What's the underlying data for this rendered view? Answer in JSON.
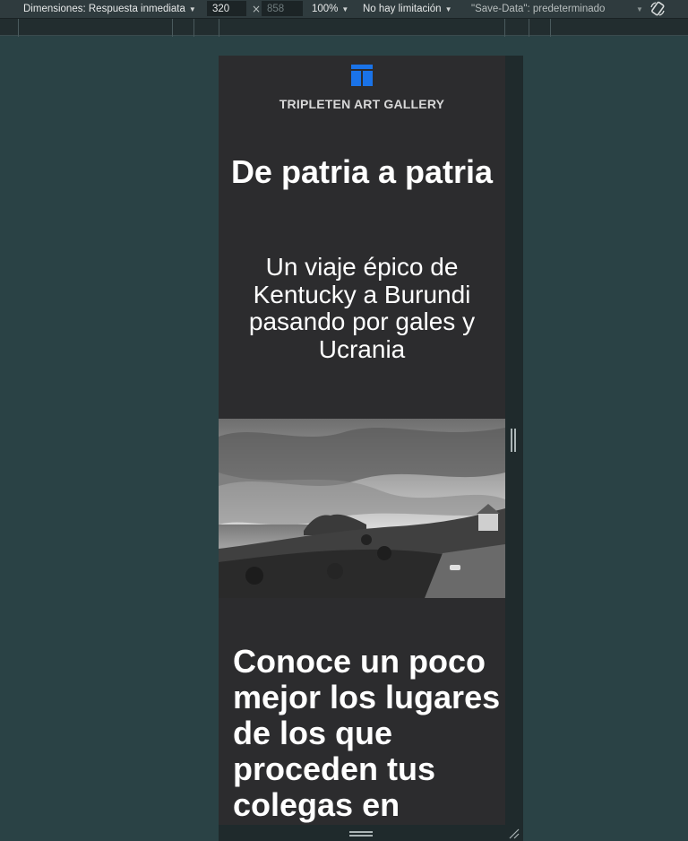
{
  "devtools": {
    "dimensions_label": "Dimensiones: Respuesta inmediata",
    "width_value": "320",
    "height_placeholder": "858",
    "times_symbol": "×",
    "zoom": "100%",
    "throttling": "No hay limitación",
    "save_data": "\"Save-Data\": predeterminado",
    "icons": [
      "chevron-down-icon",
      "rotate-icon",
      "resize-handle-icon"
    ]
  },
  "page": {
    "site_name": "TRIPLETEN ART GALLERY",
    "hero_title": "De patria a patria",
    "hero_subtitle": "Un viaje épico de Kentucky a Burundi pasando por gales y Ucrania",
    "section_title": "Conoce un poco mejor los lugares de los que proceden tus colegas en",
    "logo_icon": "gallery-logo-icon",
    "colors": {
      "background": "#2c2c2e",
      "logo": "#1a73e8",
      "text": "#ffffff"
    }
  }
}
